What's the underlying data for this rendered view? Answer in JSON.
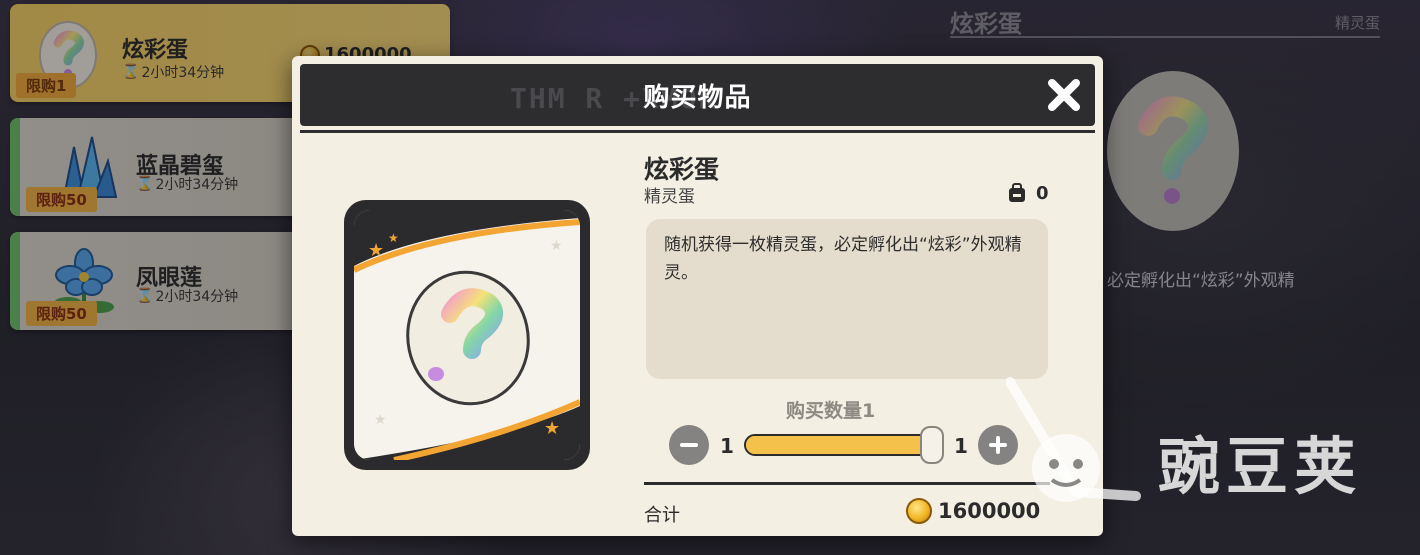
{
  "shop": {
    "items": [
      {
        "name": "炫彩蛋",
        "timer": "2小时34分钟",
        "limit": "限购1",
        "price": "1600000",
        "selected": true
      },
      {
        "name": "蓝晶碧玺",
        "timer": "2小时34分钟",
        "limit": "限购50",
        "selected": false
      },
      {
        "name": "凤眼莲",
        "timer": "2小时34分钟",
        "limit": "限购50",
        "selected": false
      }
    ]
  },
  "detail": {
    "title": "炫彩蛋",
    "category": "精灵蛋",
    "desc_peek": "灵蛋，必定孵化出“炫彩”外观精"
  },
  "modal": {
    "header_deco": "THM R      +XMON",
    "title": "购买物品",
    "item_name": "炫彩蛋",
    "item_type": "精灵蛋",
    "owned_count": "0",
    "description": "随机获得一枚精灵蛋，必定孵化出“炫彩”外观精灵。",
    "quantity_label": "购买数量1",
    "qty_min": "1",
    "qty_max": "1",
    "quantity_fraction": 1.0,
    "total_label": "合计",
    "total_price": "1600000"
  },
  "watermark": {
    "text": "豌豆荚"
  },
  "icons": {
    "close": "close-icon",
    "backpack": "backpack-icon",
    "coin": "coin-icon",
    "hourglass": "hourglass-icon"
  },
  "colors": {
    "accent_yellow": "#f3cf63",
    "modal_bg": "#f3efe3",
    "header_dark": "#2d2d2f",
    "limit_tag": "#f1a93b"
  }
}
